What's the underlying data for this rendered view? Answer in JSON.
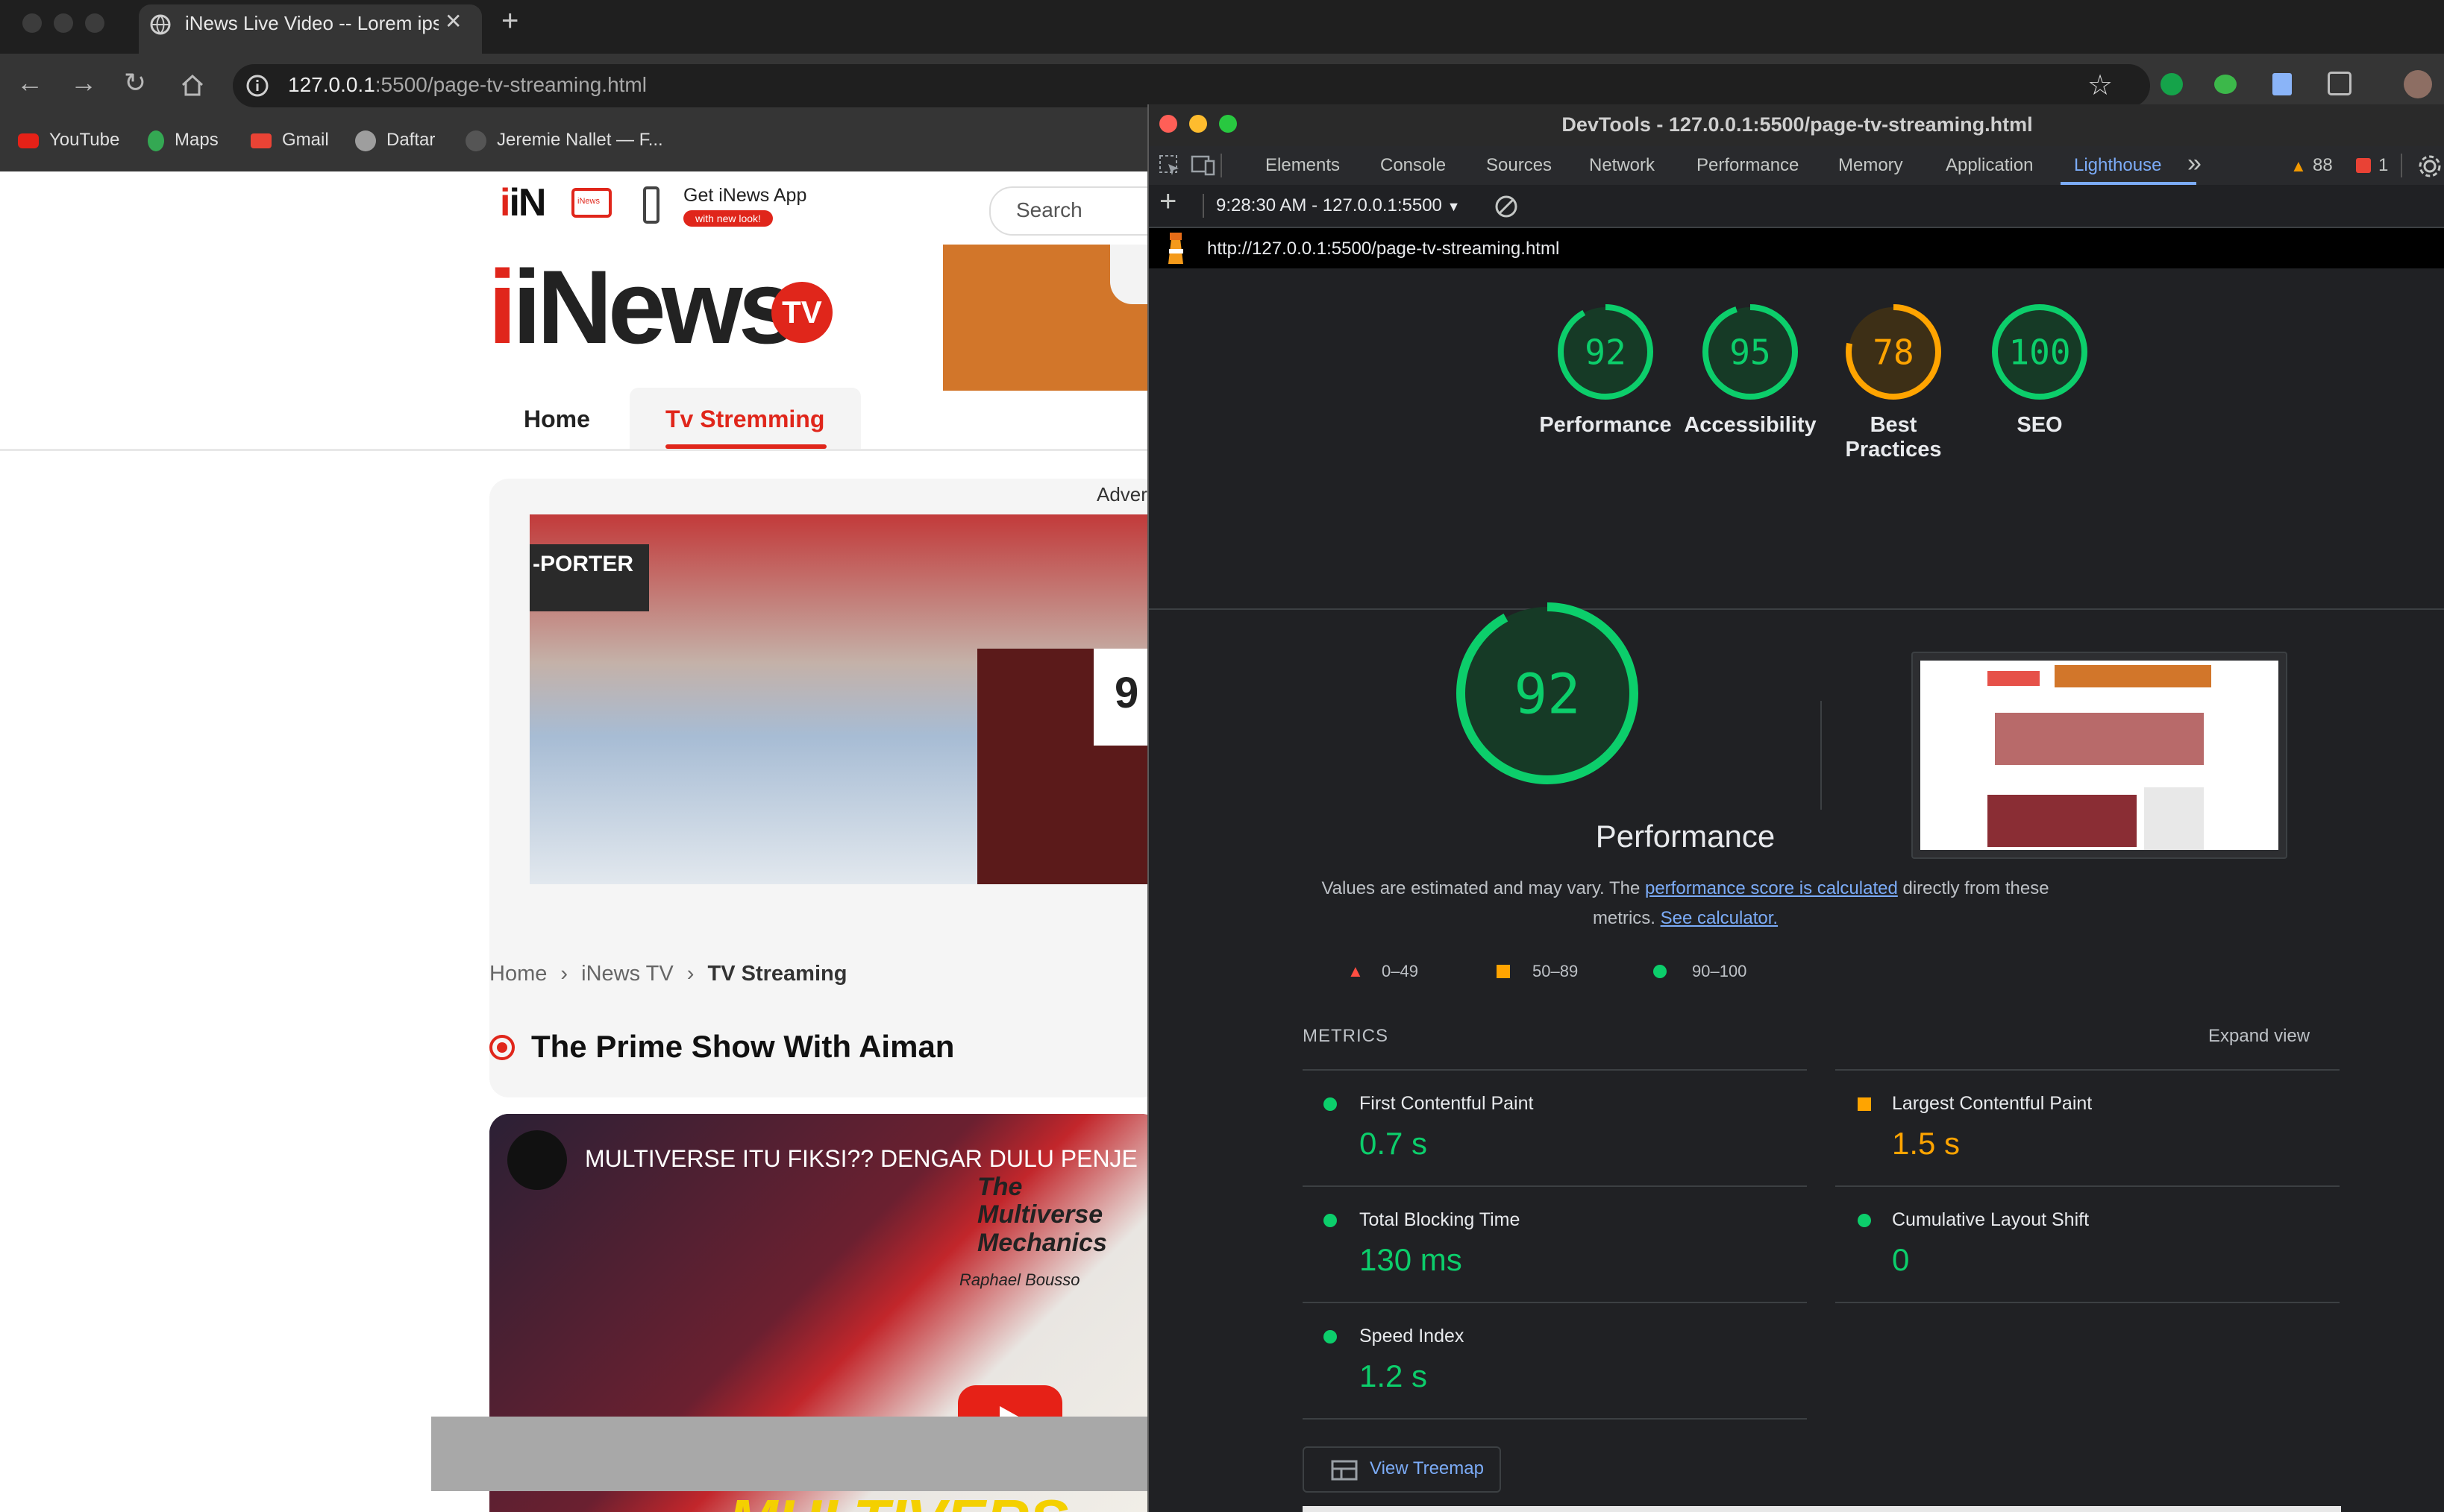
{
  "browser": {
    "tab_title": "iNews Live Video -- Lorem ipsum",
    "tab_close": "✕",
    "new_tab": "+",
    "url_host": "127.0.0.1",
    "url_rest": ":5500/page-tv-streaming.html",
    "bookmarks": [
      "YouTube",
      "Maps",
      "Gmail",
      "Daftar",
      "Jeremie Nallet — F..."
    ]
  },
  "site": {
    "logo_small": "iN",
    "tv_icon_label": "iNews",
    "get_app": "Get iNews App",
    "new_look": "with new look!",
    "search_placeholder": "Search",
    "logo_text": "iNews",
    "logo_badge": "TV",
    "nav": {
      "home": "Home",
      "tv": "Tv Stremming"
    },
    "ad_label": "Adver",
    "banner_text": "-PORTER",
    "banner_num": "9",
    "breadcrumb": [
      "Home",
      "iNews TV",
      "TV Streaming"
    ],
    "breadcrumb_sep": "›",
    "show_title": "The Prime Show With Aiman",
    "video_title": "MULTIVERSE ITU FIKSI?? DENGAR DULU PENJE",
    "video_paper_title": "The Multiverse Mechanics",
    "video_paper_author": "Raphael Bousso",
    "video_bottom": "MULTIVERS"
  },
  "devtools": {
    "window_title": "DevTools - 127.0.0.1:5500/page-tv-streaming.html",
    "tabs": [
      "Elements",
      "Console",
      "Sources",
      "Network",
      "Performance",
      "Memory",
      "Application",
      "Lighthouse"
    ],
    "more_tabs": "»",
    "warnings": "88",
    "errors": "1",
    "report_selector": "9:28:30 AM - 127.0.0.1:5500",
    "report_url": "http://127.0.0.1:5500/page-tv-streaming.html",
    "scores": [
      {
        "label": "Performance",
        "value": 92,
        "color": "#0cce6b"
      },
      {
        "label": "Accessibility",
        "value": 95,
        "color": "#0cce6b"
      },
      {
        "label": "Best Practices",
        "value": 78,
        "color": "#ffa400"
      },
      {
        "label": "SEO",
        "value": 100,
        "color": "#0cce6b"
      }
    ],
    "main_score": 92,
    "main_label": "Performance",
    "desc_pre": "Values are estimated and may vary. The ",
    "desc_link1": "performance score is calculated",
    "desc_mid": " directly from these metrics. ",
    "desc_link2": "See calculator.",
    "legend": [
      "0–49",
      "50–89",
      "90–100"
    ],
    "metrics_heading": "METRICS",
    "expand_view": "Expand view",
    "metrics": [
      {
        "name": "First Contentful Paint",
        "value": "0.7 s",
        "status": "good"
      },
      {
        "name": "Largest Contentful Paint",
        "value": "1.5 s",
        "status": "average"
      },
      {
        "name": "Total Blocking Time",
        "value": "130 ms",
        "status": "good"
      },
      {
        "name": "Cumulative Layout Shift",
        "value": "0",
        "status": "good"
      },
      {
        "name": "Speed Index",
        "value": "1.2 s",
        "status": "good"
      }
    ],
    "view_treemap": "View Treemap",
    "colors": {
      "good": "#0cce6b",
      "average": "#ffa400",
      "poor": "#ff4e42",
      "accent": "#7cacf8"
    }
  }
}
